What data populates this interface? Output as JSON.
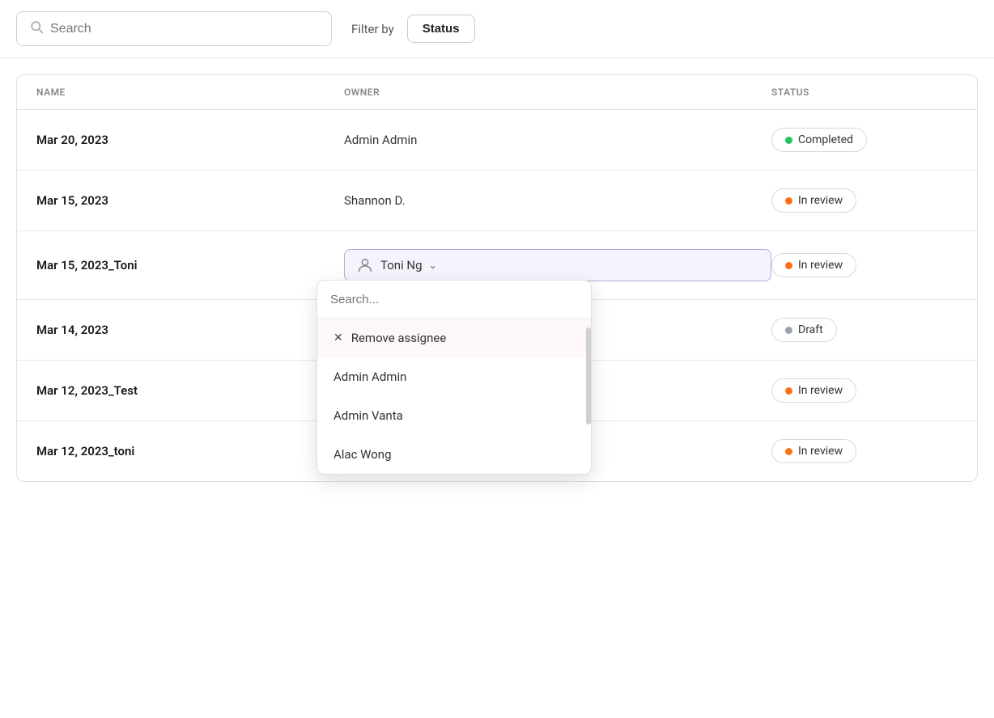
{
  "topbar": {
    "search_placeholder": "Search",
    "filter_label": "Filter by",
    "status_button": "Status"
  },
  "table": {
    "headers": {
      "name": "NAME",
      "owner": "OWNER",
      "status": "STATUS"
    },
    "rows": [
      {
        "name": "Mar 20, 2023",
        "owner": "Admin Admin",
        "status": "Completed",
        "status_type": "completed"
      },
      {
        "name": "Mar 15, 2023",
        "owner": "Shannon D.",
        "status": "In review",
        "status_type": "in-review"
      },
      {
        "name": "Mar 15, 2023_Toni",
        "owner": "Toni Ng",
        "status": "In review",
        "status_type": "in-review",
        "has_dropdown": true
      },
      {
        "name": "Mar 14, 2023",
        "owner": "",
        "status": "Draft",
        "status_type": "draft"
      },
      {
        "name": "Mar 12, 2023_Test",
        "owner": "",
        "status": "In review",
        "status_type": "in-review"
      },
      {
        "name": "Mar 12, 2023_toni",
        "owner": "",
        "status": "In review",
        "status_type": "in-review"
      }
    ]
  },
  "dropdown": {
    "search_placeholder": "Search...",
    "items": [
      {
        "label": "Remove assignee",
        "type": "remove"
      },
      {
        "label": "Admin Admin",
        "type": "user"
      },
      {
        "label": "Admin Vanta",
        "type": "user"
      },
      {
        "label": "Alac Wong",
        "type": "user"
      }
    ]
  }
}
